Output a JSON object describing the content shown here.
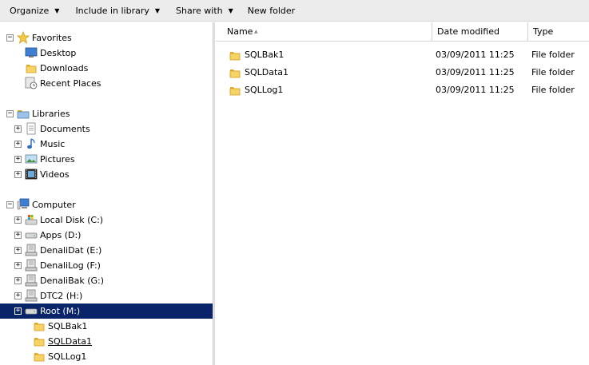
{
  "toolbar": {
    "organize": "Organize",
    "include_in_library": "Include in library",
    "share_with": "Share with",
    "new_folder": "New folder",
    "caret": "▼"
  },
  "nav": {
    "favorites": {
      "label": "Favorites",
      "items": [
        {
          "label": "Desktop",
          "icon": "desktop-icon"
        },
        {
          "label": "Downloads",
          "icon": "downloads-folder-icon"
        },
        {
          "label": "Recent Places",
          "icon": "recent-places-icon"
        }
      ]
    },
    "libraries": {
      "label": "Libraries",
      "items": [
        {
          "label": "Documents",
          "icon": "documents-icon"
        },
        {
          "label": "Music",
          "icon": "music-icon"
        },
        {
          "label": "Pictures",
          "icon": "pictures-icon"
        },
        {
          "label": "Videos",
          "icon": "videos-icon"
        }
      ]
    },
    "computer": {
      "label": "Computer",
      "drives": [
        {
          "label": "Local Disk (C:)"
        },
        {
          "label": "Apps (D:)"
        },
        {
          "label": "DenaliDat (E:)"
        },
        {
          "label": "DenaliLog (F:)"
        },
        {
          "label": "DenaliBak (G:)"
        },
        {
          "label": "DTC2 (H:)"
        },
        {
          "label": "Root (M:)"
        }
      ],
      "root_children": [
        {
          "label": "SQLBak1"
        },
        {
          "label": "SQLData1"
        },
        {
          "label": "SQLLog1"
        }
      ]
    },
    "expander_plus": "+",
    "expander_minus": "−"
  },
  "content": {
    "columns": {
      "name": "Name",
      "date_modified": "Date modified",
      "type": "Type"
    },
    "sort_indicator": "▲",
    "files": [
      {
        "name": "SQLBak1",
        "date": "03/09/2011 11:25",
        "type": "File folder"
      },
      {
        "name": "SQLData1",
        "date": "03/09/2011 11:25",
        "type": "File folder"
      },
      {
        "name": "SQLLog1",
        "date": "03/09/2011 11:25",
        "type": "File folder"
      }
    ]
  },
  "colors": {
    "selection": "#0a246a",
    "folder": "#f2c84b"
  }
}
